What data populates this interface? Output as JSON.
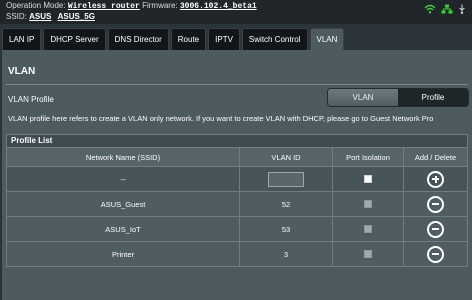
{
  "top": {
    "op_mode_label": "Operation Mode:",
    "op_mode_value": "Wireless router",
    "firmware_label": "Firmware:",
    "firmware_value": "3006.102.4_beta1",
    "ssid_label": "SSID:",
    "ssid_1": "ASUS",
    "ssid_2": "ASUS_5G"
  },
  "tabs": [
    "LAN IP",
    "DHCP Server",
    "DNS Director",
    "Route",
    "IPTV",
    "Switch Control",
    "VLAN"
  ],
  "active_tab": "VLAN",
  "panel": {
    "title": "VLAN",
    "profile_label": "VLAN Profile",
    "segment": {
      "vlan": "VLAN",
      "profile": "Profile",
      "selected": "Profile"
    },
    "description": "VLAN profile here refers to create a VLAN only network. If you want to create VLAN with DHCP, please go to Guest Network Pro"
  },
  "table": {
    "title": "Profile List",
    "columns": [
      "Network Name (SSID)",
      "VLAN ID",
      "Port Isolation",
      "Add / Delete"
    ],
    "input_row": {
      "name": "--",
      "vlan_id": "",
      "port_isolation": false
    },
    "rows": [
      {
        "name": "ASUS_Guest",
        "vlan_id": "52",
        "port_isolation": false
      },
      {
        "name": "ASUS_IoT",
        "vlan_id": "53",
        "port_isolation": false
      },
      {
        "name": "Printer",
        "vlan_id": "3",
        "port_isolation": false
      }
    ]
  },
  "colors": {
    "accent_green": "#3ccf3c",
    "panel": "#4d5a5f",
    "background": "#2b3438"
  },
  "icons": [
    "wifi-icon",
    "network-icon",
    "usb-icon",
    "add-icon",
    "delete-icon"
  ]
}
